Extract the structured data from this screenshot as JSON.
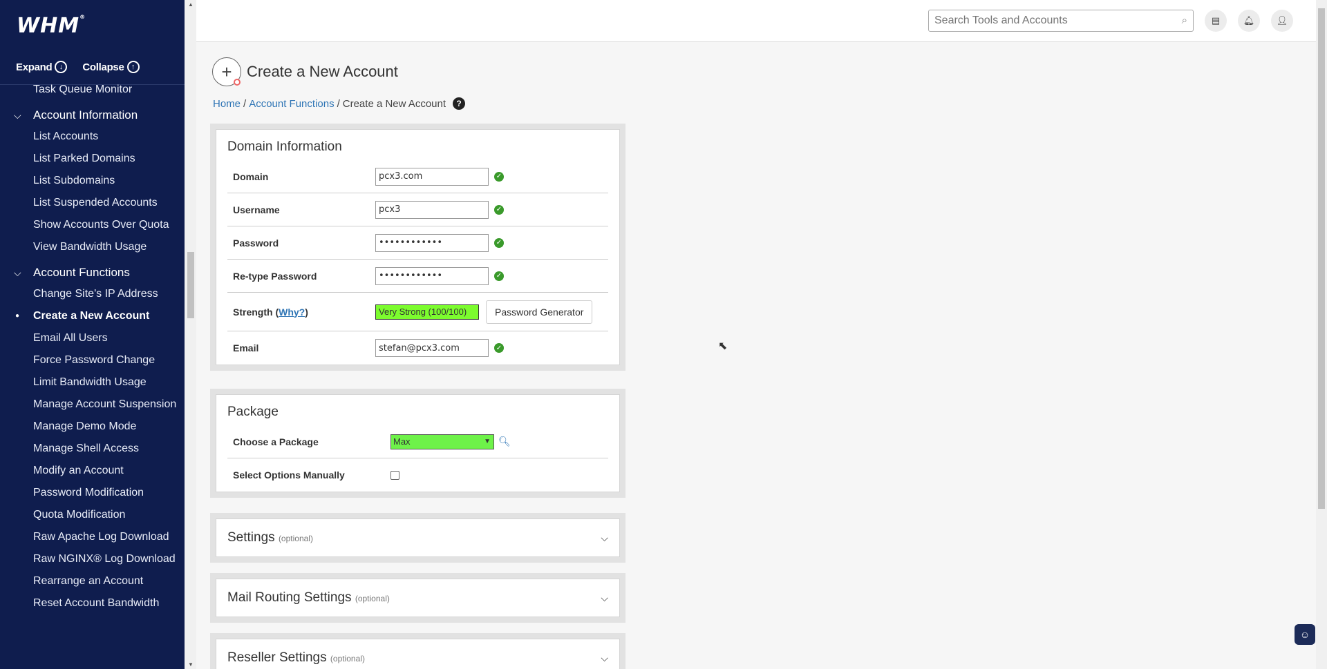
{
  "brand": {
    "logo": "WHM",
    "mark": "®"
  },
  "sidebar": {
    "expand_label": "Expand",
    "collapse_label": "Collapse",
    "items_top": [
      "Task Queue Monitor"
    ],
    "sections": [
      {
        "title": "Account Information",
        "items": [
          "List Accounts",
          "List Parked Domains",
          "List Subdomains",
          "List Suspended Accounts",
          "Show Accounts Over Quota",
          "View Bandwidth Usage"
        ]
      },
      {
        "title": "Account Functions",
        "items": [
          "Change Site's IP Address",
          "Create a New Account",
          "Email All Users",
          "Force Password Change",
          "Limit Bandwidth Usage",
          "Manage Account Suspension",
          "Manage Demo Mode",
          "Manage Shell Access",
          "Modify an Account",
          "Password Modification",
          "Quota Modification",
          "Raw Apache Log Download",
          "Raw NGINX® Log Download",
          "Rearrange an Account",
          "Reset Account Bandwidth"
        ]
      }
    ],
    "active_item": "Create a New Account"
  },
  "topbar": {
    "search_placeholder": "Search Tools and Accounts"
  },
  "page": {
    "title": "Create a New Account",
    "breadcrumb": [
      {
        "label": "Home"
      },
      {
        "label": "Account Functions"
      },
      {
        "label": "Create a New Account"
      }
    ]
  },
  "domain_info": {
    "title": "Domain Information",
    "domain_label": "Domain",
    "domain_value": "pcx3.com",
    "username_label": "Username",
    "username_value": "pcx3",
    "password_label": "Password",
    "password_value": "••••••••••••",
    "retype_label": "Re-type Password",
    "retype_value": "••••••••••••",
    "strength_label": "Strength (",
    "strength_why": "Why?",
    "strength_close": ")",
    "strength_value": "Very Strong (100/100)",
    "strength_percent": 100,
    "pw_gen_label": "Password Generator",
    "email_label": "Email",
    "email_value": "stefan@pcx3.com"
  },
  "package": {
    "title": "Package",
    "choose_label": "Choose a Package",
    "choose_value": "Max",
    "manual_label": "Select Options Manually"
  },
  "collapsed_sections": [
    {
      "title": "Settings",
      "optional": "(optional)"
    },
    {
      "title": "Mail Routing Settings",
      "optional": "(optional)"
    },
    {
      "title": "Reseller Settings",
      "optional": "(optional)"
    }
  ]
}
